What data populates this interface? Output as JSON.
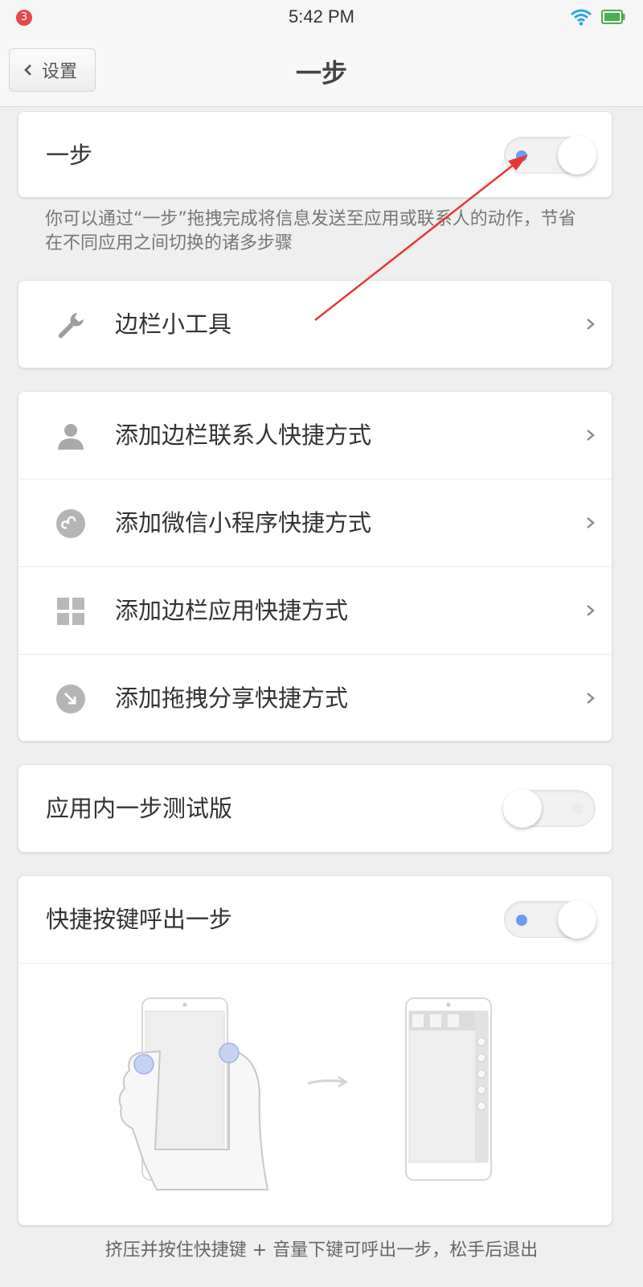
{
  "status_bar": {
    "notification_count": "3",
    "time": "5:42 PM"
  },
  "header": {
    "back_label": "设置",
    "title": "一步"
  },
  "main_toggle": {
    "label": "一步",
    "state": "on"
  },
  "description": "你可以通过“一步”拖拽完成将信息发送至应用或联系人的动作，节省在不同应用之间切换的诸多步骤",
  "sidebar_tools": {
    "label": "边栏小工具"
  },
  "shortcuts": [
    {
      "label": "添加边栏联系人快捷方式"
    },
    {
      "label": "添加微信小程序快捷方式"
    },
    {
      "label": "添加边栏应用快捷方式"
    },
    {
      "label": "添加拖拽分享快捷方式"
    }
  ],
  "in_app_beta": {
    "label": "应用内一步测试版",
    "state": "off"
  },
  "hotkey": {
    "label": "快捷按键呼出一步",
    "state": "on"
  },
  "footer_hint": "挤压并按住快捷键 + 音量下键可呼出一步，松手后退出",
  "colors": {
    "accent": "#6e9df0",
    "annotation_arrow": "#e53935"
  }
}
